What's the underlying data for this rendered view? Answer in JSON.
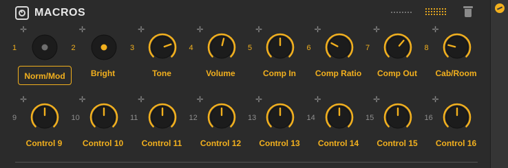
{
  "header": {
    "title": "MACROS"
  },
  "icons": {
    "header": "macro-knob-icon",
    "sidebar": "macro-sidebar-icon",
    "layout_compact": "dots-grid-icon",
    "layout_full": "dots-grid-icon",
    "trash": "trash-icon",
    "move": "move-arrows-icon"
  },
  "colors": {
    "accent": "#f2b01e",
    "background": "#2b2b2b",
    "label": "#f2b01e",
    "knob": "#1c1c1c"
  },
  "macros": [
    {
      "num": "1",
      "label": "Norm/Mod",
      "type": "toggle",
      "state": "off",
      "selected": true
    },
    {
      "num": "2",
      "label": "Bright",
      "type": "toggle",
      "state": "on"
    },
    {
      "num": "3",
      "label": "Tone",
      "type": "knob",
      "value": 0.76
    },
    {
      "num": "4",
      "label": "Volume",
      "type": "knob",
      "value": 0.55
    },
    {
      "num": "5",
      "label": "Comp In",
      "type": "knob",
      "value": 0.5
    },
    {
      "num": "6",
      "label": "Comp Ratio",
      "type": "knob",
      "value": 0.27
    },
    {
      "num": "7",
      "label": "Comp Out",
      "type": "knob",
      "value": 0.65
    },
    {
      "num": "8",
      "label": "Cab/Room",
      "type": "knob",
      "value": 0.22
    },
    {
      "num": "9",
      "label": "Control 9",
      "type": "knob",
      "value": 0.5
    },
    {
      "num": "10",
      "label": "Control 10",
      "type": "knob",
      "value": 0.5
    },
    {
      "num": "11",
      "label": "Control 11",
      "type": "knob",
      "value": 0.5
    },
    {
      "num": "12",
      "label": "Control 12",
      "type": "knob",
      "value": 0.5
    },
    {
      "num": "13",
      "label": "Control 13",
      "type": "knob",
      "value": 0.5
    },
    {
      "num": "14",
      "label": "Control 14",
      "type": "knob",
      "value": 0.5
    },
    {
      "num": "15",
      "label": "Control 15",
      "type": "knob",
      "value": 0.5
    },
    {
      "num": "16",
      "label": "Control 16",
      "type": "knob",
      "value": 0.5
    }
  ]
}
